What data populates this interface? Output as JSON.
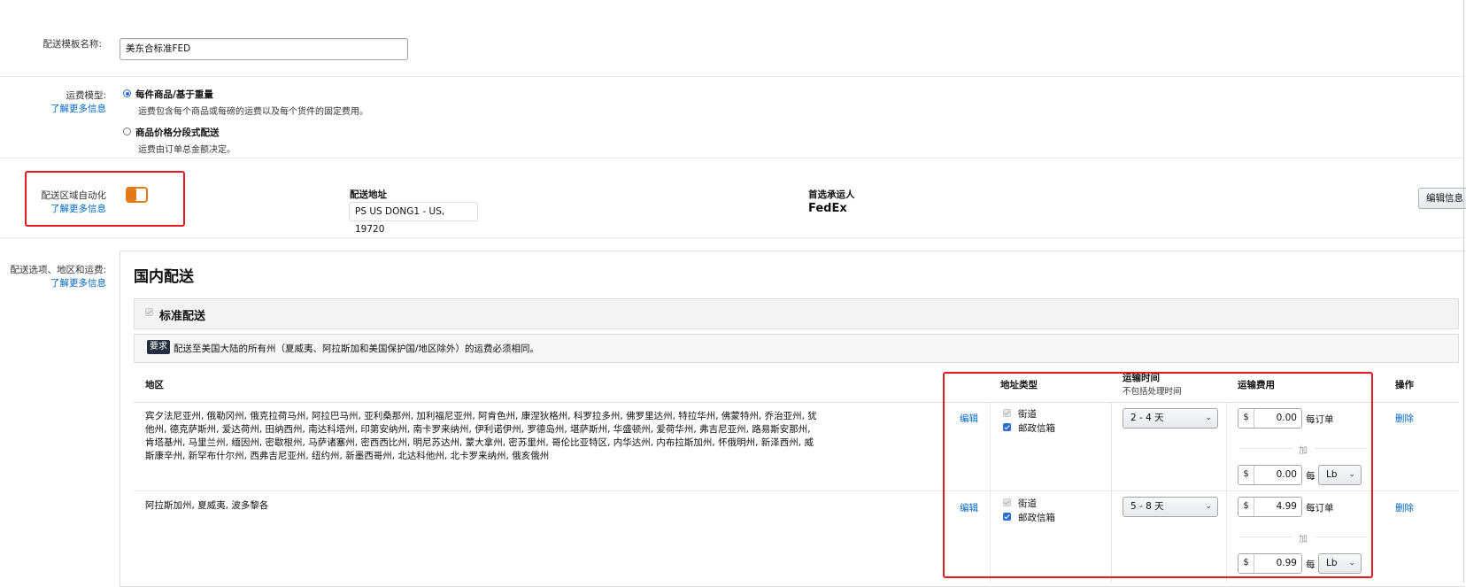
{
  "template_name": {
    "label": "配送模板名称:",
    "value": "美东合标准FED"
  },
  "fee_model": {
    "label": "运费模型:",
    "learn_more": "了解更多信息",
    "options": [
      {
        "title": "每件商品/基于重量",
        "desc": "运费包含每个商品或每磅的运费以及每个货件的固定费用。",
        "selected": true
      },
      {
        "title": "商品价格分段式配送",
        "desc": "运费由订单总金额决定。",
        "selected": false
      }
    ]
  },
  "automation": {
    "label": "配送区域自动化",
    "learn_more": "了解更多信息",
    "toggle_on": true,
    "ship_from_label": "配送地址",
    "ship_from_value": "PS US DONG1 - US, 19720",
    "carrier_label": "首选承运人",
    "carrier_value": "FedEx",
    "edit_button": "编辑信息"
  },
  "options_section": {
    "label": "配送选项、地区和运费:",
    "learn_more": "了解更多信息",
    "domestic_title": "国内配送",
    "standard_title": "标准配送",
    "requirement_badge": "要求",
    "requirement_text": "配送至美国大陆的所有州（夏威夷、阿拉斯加和美国保护国/地区除外）的运费必须相同。"
  },
  "table": {
    "headers": {
      "region": "地区",
      "address_type": "地址类型",
      "transit_time": "运输时间",
      "transit_sub": "不包括处理时间",
      "shipping_fee": "运输费用",
      "action": "操作"
    },
    "rows": [
      {
        "regions": "宾夕法尼亚州, 俄勒冈州, 俄克拉荷马州, 阿拉巴马州, 亚利桑那州, 加利福尼亚州, 阿肯色州, 康涅狄格州, 科罗拉多州, 佛罗里达州, 特拉华州, 佛蒙特州, 乔治亚州, 犹他州, 德克萨斯州, 爱达荷州, 田纳西州, 南达科塔州, 印第安纳州, 南卡罗来纳州, 伊利诺伊州, 罗德岛州, 堪萨斯州, 华盛顿州, 爱荷华州, 弗吉尼亚州, 路易斯安那州, 肯塔基州, 马里兰州, 缅因州, 密歇根州, 马萨诸塞州, 密西西比州, 明尼苏达州, 蒙大拿州, 密苏里州, 哥伦比亚特区, 内华达州, 内布拉斯加州, 怀俄明州, 新泽西州, 威斯康辛州, 新罕布什尔州, 西弗吉尼亚州, 纽约州, 新墨西哥州, 北达科他州, 北卡罗来纳州, 俄亥俄州",
        "edit": "编辑",
        "street": "街道",
        "po_box": "邮政信箱",
        "transit": "2 - 4 天",
        "currency": "$",
        "per_order": "0.00",
        "per_order_label": "每订单",
        "plus": "加",
        "per_unit": "0.00",
        "per_label": "每",
        "unit": "Lb",
        "delete": "删除"
      },
      {
        "regions": "阿拉斯加州, 夏威夷, 波多黎各",
        "edit": "编辑",
        "street": "街道",
        "po_box": "邮政信箱",
        "transit": "5 - 8 天",
        "currency": "$",
        "per_order": "4.99",
        "per_order_label": "每订单",
        "plus": "加",
        "per_unit": "0.99",
        "per_label": "每",
        "unit": "Lb",
        "delete": "删除"
      }
    ]
  },
  "colors": {
    "accent_orange": "#e47911",
    "link_blue": "#0066c0",
    "highlight_red": "#e31b23"
  }
}
